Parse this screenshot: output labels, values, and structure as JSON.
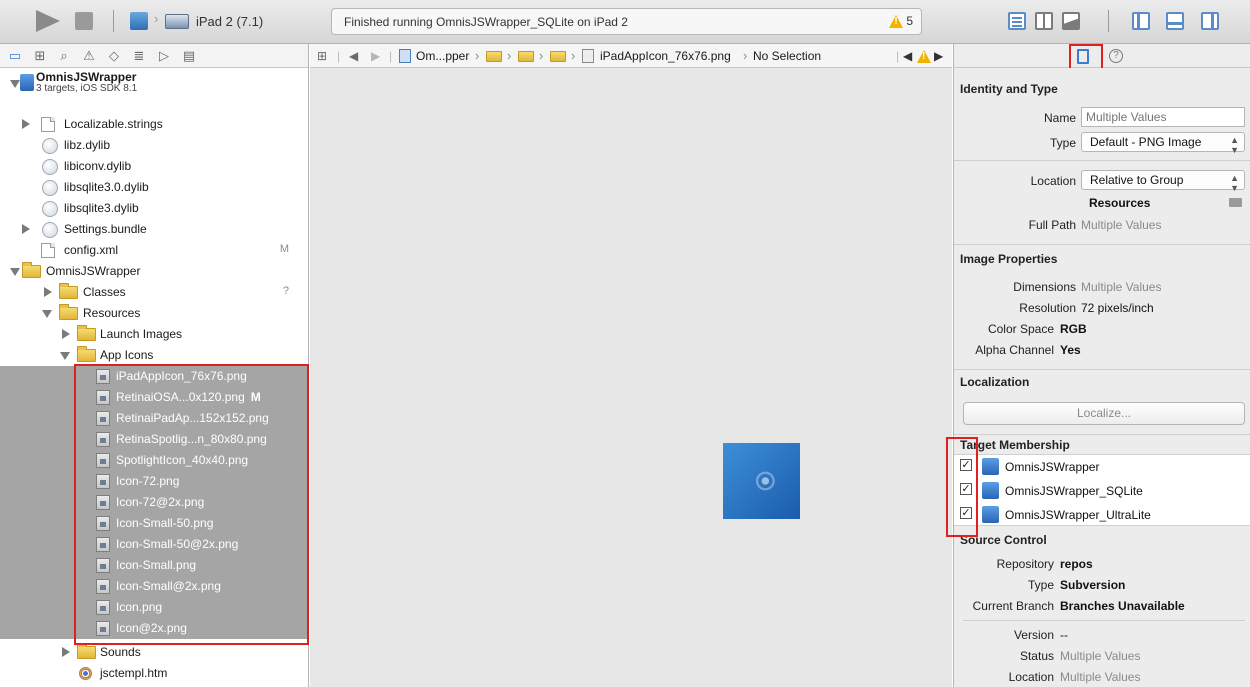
{
  "toolbar": {
    "device_label": "iPad 2 (7.1)",
    "status_text": "Finished running OmnisJSWrapper_SQLite on iPad 2",
    "warning_count": "5"
  },
  "navigator": {
    "project": {
      "name": "OmnisJSWrapper",
      "subtitle": "3 targets, iOS SDK 8.1"
    },
    "rows": [
      {
        "label": "Localizable.strings",
        "badge": ""
      },
      {
        "label": "libz.dylib",
        "badge": ""
      },
      {
        "label": "libiconv.dylib",
        "badge": ""
      },
      {
        "label": "libsqlite3.0.dylib",
        "badge": ""
      },
      {
        "label": "libsqlite3.dylib",
        "badge": ""
      },
      {
        "label": "Settings.bundle",
        "badge": ""
      },
      {
        "label": "config.xml",
        "badge": "M"
      },
      {
        "label": "OmnisJSWrapper",
        "badge": ""
      },
      {
        "label": "Classes",
        "badge": "?"
      },
      {
        "label": "Resources",
        "badge": ""
      },
      {
        "label": "Launch Images",
        "badge": ""
      },
      {
        "label": "App Icons",
        "badge": ""
      },
      {
        "label": "iPadAppIcon_76x76.png",
        "badge": ""
      },
      {
        "label": "RetinaiOSA...0x120.png",
        "badge": "M"
      },
      {
        "label": "RetinaiPadAp...152x152.png",
        "badge": ""
      },
      {
        "label": "RetinaSpotlig...n_80x80.png",
        "badge": ""
      },
      {
        "label": "SpotlightIcon_40x40.png",
        "badge": ""
      },
      {
        "label": "Icon-72.png",
        "badge": ""
      },
      {
        "label": "Icon-72@2x.png",
        "badge": ""
      },
      {
        "label": "Icon-Small-50.png",
        "badge": ""
      },
      {
        "label": "Icon-Small-50@2x.png",
        "badge": ""
      },
      {
        "label": "Icon-Small.png",
        "badge": ""
      },
      {
        "label": "Icon-Small@2x.png",
        "badge": ""
      },
      {
        "label": "Icon.png",
        "badge": ""
      },
      {
        "label": "Icon@2x.png",
        "badge": ""
      },
      {
        "label": "Sounds",
        "badge": ""
      },
      {
        "label": "jsctempl.htm",
        "badge": ""
      }
    ]
  },
  "jumpbar": {
    "crumb_project": "Om...pper",
    "crumb_file": "iPadAppIcon_76x76.png",
    "crumb_selection": "No Selection"
  },
  "inspector": {
    "identity": {
      "title": "Identity and Type",
      "name_label": "Name",
      "name_placeholder": "Multiple Values",
      "type_label": "Type",
      "type_value": "Default - PNG Image",
      "location_label": "Location",
      "location_value": "Relative to Group",
      "location_path": "Resources",
      "full_path_label": "Full Path",
      "full_path_value": "Multiple Values"
    },
    "image_props": {
      "title": "Image Properties",
      "rows": [
        {
          "label": "Dimensions",
          "value": "Multiple Values"
        },
        {
          "label": "Resolution",
          "value": "72 pixels/inch"
        },
        {
          "label": "Color Space",
          "value": "RGB"
        },
        {
          "label": "Alpha Channel",
          "value": "Yes"
        }
      ]
    },
    "localization": {
      "title": "Localization",
      "button": "Localize..."
    },
    "target_membership": {
      "title": "Target Membership",
      "targets": [
        {
          "name": "OmnisJSWrapper",
          "checked": "✓"
        },
        {
          "name": "OmnisJSWrapper_SQLite",
          "checked": "✓"
        },
        {
          "name": "OmnisJSWrapper_UltraLite",
          "checked": "✓"
        }
      ]
    },
    "source_control": {
      "title": "Source Control",
      "rows": [
        {
          "label": "Repository",
          "value": "repos"
        },
        {
          "label": "Type",
          "value": "Subversion"
        },
        {
          "label": "Current Branch",
          "value": "Branches Unavailable"
        }
      ],
      "version_label": "Version",
      "version_value": "--",
      "status_label": "Status",
      "status_value": "Multiple Values",
      "location_label": "Location",
      "location_value": "Multiple Values"
    }
  }
}
